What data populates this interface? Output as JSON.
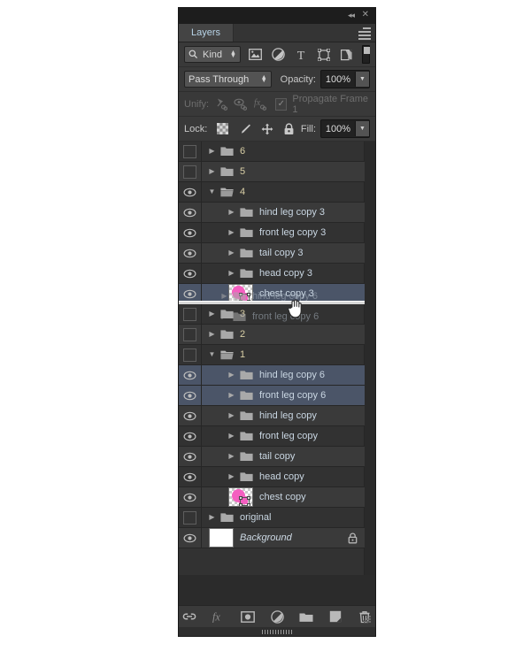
{
  "window": {
    "collapse_icon": "collapse-double-arrow-icon",
    "close_icon": "close-icon"
  },
  "panel": {
    "tab_label": "Layers",
    "menu_icon": "panel-menu-icon"
  },
  "filter_bar": {
    "kind_label": "Kind",
    "search_icon": "search-icon",
    "icons": [
      {
        "name": "pixel-layer-filter-icon"
      },
      {
        "name": "adjustment-layer-filter-icon"
      },
      {
        "name": "type-layer-filter-icon"
      },
      {
        "name": "shape-layer-filter-icon"
      },
      {
        "name": "smart-object-filter-icon"
      }
    ],
    "toggle_icon": "filter-enable-toggle"
  },
  "blend_bar": {
    "mode": "Pass Through",
    "opacity_label": "Opacity:",
    "opacity_value": "100%"
  },
  "unify_bar": {
    "label": "Unify:",
    "icons": [
      {
        "name": "unify-position-icon"
      },
      {
        "name": "unify-visibility-icon"
      },
      {
        "name": "unify-style-icon"
      }
    ],
    "propagate_label": "Propagate Frame 1",
    "propagate_checked": true
  },
  "lock_bar": {
    "label": "Lock:",
    "icons": [
      {
        "name": "lock-transparent-pixels-icon"
      },
      {
        "name": "lock-image-pixels-icon"
      },
      {
        "name": "lock-position-icon"
      },
      {
        "name": "lock-all-icon"
      }
    ],
    "fill_label": "Fill:",
    "fill_value": "100%"
  },
  "layers": [
    {
      "name": "6",
      "type": "group",
      "indent": 0,
      "visible": false,
      "expanded": false,
      "selected": false,
      "numeric": true
    },
    {
      "name": "5",
      "type": "group",
      "indent": 0,
      "visible": false,
      "expanded": false,
      "selected": false,
      "numeric": true
    },
    {
      "name": "4",
      "type": "group",
      "indent": 0,
      "visible": true,
      "expanded": true,
      "selected": false,
      "numeric": true
    },
    {
      "name": "hind leg copy 3",
      "type": "group",
      "indent": 1,
      "visible": true,
      "expanded": false,
      "selected": false
    },
    {
      "name": "front leg copy 3",
      "type": "group",
      "indent": 1,
      "visible": true,
      "expanded": false,
      "selected": false
    },
    {
      "name": "tail copy 3",
      "type": "group",
      "indent": 1,
      "visible": true,
      "expanded": false,
      "selected": false
    },
    {
      "name": "head copy 3",
      "type": "group",
      "indent": 1,
      "visible": true,
      "expanded": false,
      "selected": false
    },
    {
      "name": "chest copy 3",
      "type": "image",
      "indent": 1,
      "visible": true,
      "expanded": false,
      "selected": true
    },
    {
      "name": "3",
      "type": "group",
      "indent": 0,
      "visible": false,
      "expanded": false,
      "selected": false,
      "numeric": true
    },
    {
      "name": "2",
      "type": "group",
      "indent": 0,
      "visible": false,
      "expanded": false,
      "selected": false,
      "numeric": true
    },
    {
      "name": "1",
      "type": "group",
      "indent": 0,
      "visible": false,
      "expanded": true,
      "selected": false,
      "numeric": true
    },
    {
      "name": "hind leg copy 6",
      "type": "group",
      "indent": 1,
      "visible": true,
      "expanded": false,
      "selected": true
    },
    {
      "name": "front leg copy 6",
      "type": "group",
      "indent": 1,
      "visible": true,
      "expanded": false,
      "selected": true
    },
    {
      "name": "hind leg copy",
      "type": "group",
      "indent": 1,
      "visible": true,
      "expanded": false,
      "selected": false
    },
    {
      "name": "front leg copy",
      "type": "group",
      "indent": 1,
      "visible": true,
      "expanded": false,
      "selected": false
    },
    {
      "name": "tail copy",
      "type": "group",
      "indent": 1,
      "visible": true,
      "expanded": false,
      "selected": false
    },
    {
      "name": "head copy",
      "type": "group",
      "indent": 1,
      "visible": true,
      "expanded": false,
      "selected": false
    },
    {
      "name": "chest copy",
      "type": "image",
      "indent": 1,
      "visible": true,
      "expanded": false,
      "selected": false
    },
    {
      "name": "original",
      "type": "group",
      "indent": 0,
      "visible": false,
      "expanded": false,
      "selected": false
    },
    {
      "name": "Background",
      "type": "background",
      "indent": 0,
      "visible": true,
      "expanded": false,
      "selected": false,
      "locked": true
    }
  ],
  "drag": {
    "ghost_layers": [
      "hind leg copy 6",
      "front leg copy 6"
    ],
    "drop_indicator": true,
    "cursor_icon": "grabbing-hand-cursor"
  },
  "bottom_bar": {
    "icons": [
      {
        "name": "link-layers-icon"
      },
      {
        "name": "layer-style-fx-icon"
      },
      {
        "name": "add-layer-mask-icon"
      },
      {
        "name": "new-adjustment-layer-icon"
      },
      {
        "name": "new-group-icon"
      },
      {
        "name": "new-layer-icon"
      },
      {
        "name": "delete-layer-icon"
      }
    ],
    "resize_grip": "resize-grip-icon"
  },
  "colors": {
    "panel_bg": "#2b2b2b",
    "list_bg": "#323232",
    "row_alt": "#3a3a3a",
    "selected_row": "#4b5568",
    "text": "#c9d6e2",
    "numeric_text": "#d9cfa6",
    "tab_text": "#b8d4e8",
    "thumb_accent": "#f45fc0"
  }
}
